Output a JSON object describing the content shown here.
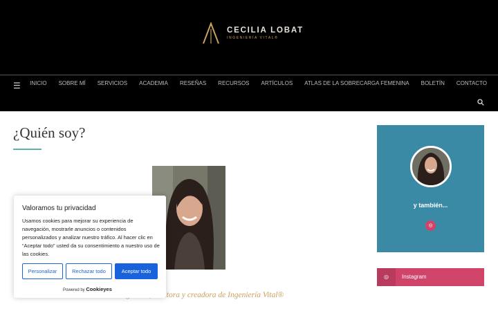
{
  "brand": {
    "name": "CECILIA LOBAT",
    "tagline": "INGENIERÍA VITAL®",
    "gold": "#c9a15a"
  },
  "nav": {
    "menu_icon": "hamburger-icon",
    "items": [
      {
        "label": "INICIO"
      },
      {
        "label": "SOBRE MÍ"
      },
      {
        "label": "SERVICIOS"
      },
      {
        "label": "ACADEMIA"
      },
      {
        "label": "RESEÑAS"
      },
      {
        "label": "RECURSOS"
      },
      {
        "label": "ARTÍCULOS"
      },
      {
        "label": "ATLAS DE LA SOBRECARGA FEMENINA"
      },
      {
        "label": "BOLETÍN"
      },
      {
        "label": "CONTACTO"
      }
    ],
    "search_icon": "search-icon"
  },
  "main": {
    "title": "¿Quién soy?",
    "accent": "#5fb3a3",
    "caption": "Investigadora, mentora y creadora de Ingeniería Vital®"
  },
  "sidebar": {
    "heading": "y también...",
    "bg": "#3a8aa6",
    "social_icon": "instagram-icon",
    "instagram_label": "Instagram",
    "instagram_color": "#d0446a"
  },
  "cookie_banner": {
    "title": "Valoramos tu privacidad",
    "text": "Usamos cookies para mejorar su experiencia de navegación, mostrarle anuncios o contenidos personalizados y analizar nuestro tráfico. Al hacer clic en “Aceptar todo” usted da su consentimiento a nuestro uso de las cookies.",
    "buttons": {
      "customize": "Personalizar",
      "reject": "Rechazar todo",
      "accept": "Aceptar todo"
    },
    "powered_by": "Powered by",
    "powered_brand": "Cookieyes",
    "accent": "#1863dc"
  }
}
